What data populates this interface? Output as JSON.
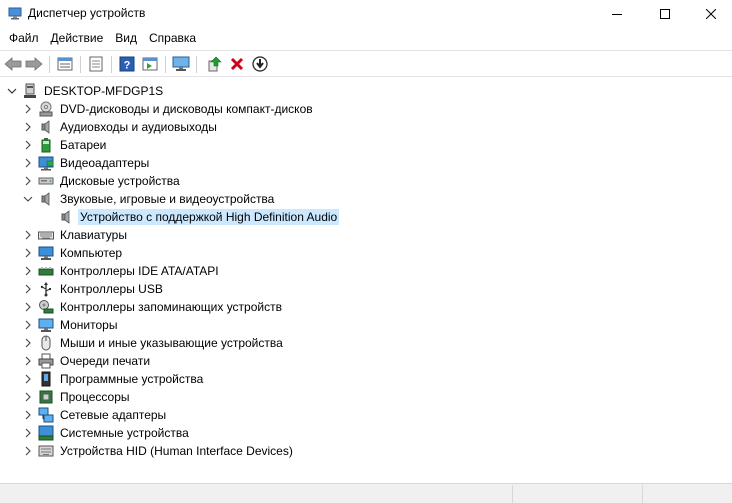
{
  "window": {
    "title": "Диспетчер устройств",
    "controls": {
      "minimize": "minimize",
      "maximize": "maximize",
      "close": "close"
    }
  },
  "menu": [
    "Файл",
    "Действие",
    "Вид",
    "Справка"
  ],
  "toolbar": {
    "buttons": [
      "back-arrow-icon",
      "forward-arrow-icon",
      "properties-list-icon",
      "device-sheet-icon",
      "help-icon",
      "view-panel-icon",
      "monitor-scan-icon",
      "update-driver-icon",
      "uninstall-icon",
      "download-driver-icon"
    ]
  },
  "tree": {
    "root": "DESKTOP-MFDGP1S",
    "categories": [
      {
        "label": "DVD-дисководы и дисководы компакт-дисков",
        "icon": "dvd-drive-icon",
        "expanded": false
      },
      {
        "label": "Аудиовходы и аудиовыходы",
        "icon": "speaker-icon",
        "expanded": false
      },
      {
        "label": "Батареи",
        "icon": "battery-icon",
        "expanded": false
      },
      {
        "label": "Видеоадаптеры",
        "icon": "display-adapter-icon",
        "expanded": false
      },
      {
        "label": "Дисковые устройства",
        "icon": "disk-drive-icon",
        "expanded": false
      },
      {
        "label": "Звуковые, игровые и видеоустройства",
        "icon": "speaker-icon",
        "expanded": true,
        "children": [
          {
            "label": "Устройство с поддержкой High Definition Audio",
            "icon": "speaker-icon",
            "selected": true
          }
        ]
      },
      {
        "label": "Клавиатуры",
        "icon": "keyboard-icon",
        "expanded": false
      },
      {
        "label": "Компьютер",
        "icon": "computer-icon",
        "expanded": false
      },
      {
        "label": "Контроллеры IDE ATA/ATAPI",
        "icon": "ide-controller-icon",
        "expanded": false
      },
      {
        "label": "Контроллеры USB",
        "icon": "usb-icon",
        "expanded": false
      },
      {
        "label": "Контроллеры запоминающих устройств",
        "icon": "storage-controller-icon",
        "expanded": false
      },
      {
        "label": "Мониторы",
        "icon": "monitor-icon",
        "expanded": false
      },
      {
        "label": "Мыши и иные указывающие устройства",
        "icon": "mouse-icon",
        "expanded": false
      },
      {
        "label": "Очереди печати",
        "icon": "printer-icon",
        "expanded": false
      },
      {
        "label": "Программные устройства",
        "icon": "software-device-icon",
        "expanded": false
      },
      {
        "label": "Процессоры",
        "icon": "processor-icon",
        "expanded": false
      },
      {
        "label": "Сетевые адаптеры",
        "icon": "network-adapter-icon",
        "expanded": false
      },
      {
        "label": "Системные устройства",
        "icon": "system-device-icon",
        "expanded": false
      },
      {
        "label": "Устройства HID (Human Interface Devices)",
        "icon": "hid-icon",
        "expanded": false
      }
    ]
  },
  "colors": {
    "selection": "#cce8ff",
    "accent_blue": "#1e6fc8",
    "uninstall_red": "#d0021b",
    "update_green": "#1f9d2f"
  }
}
